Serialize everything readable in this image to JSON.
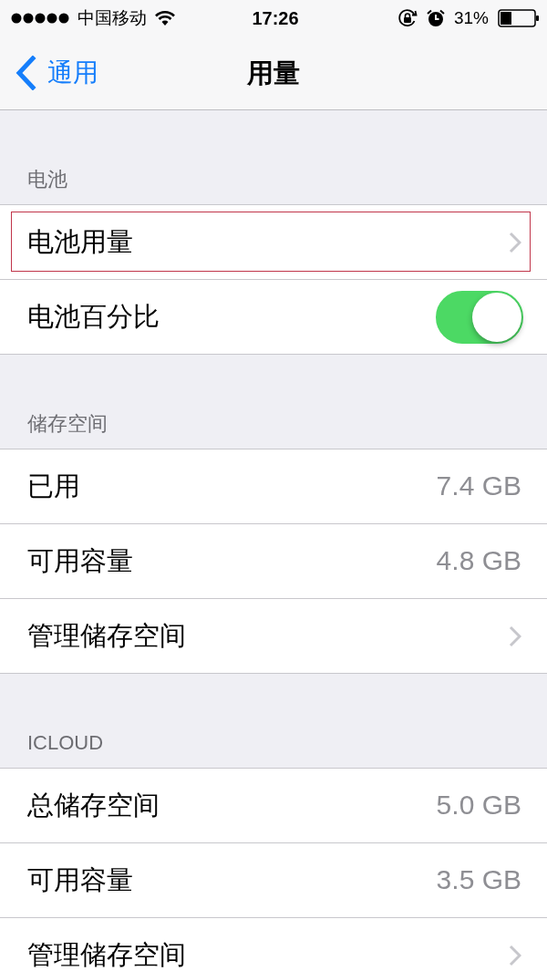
{
  "status_bar": {
    "carrier": "中国移动",
    "time": "17:26",
    "battery_percent": "31%"
  },
  "nav": {
    "back": "通用",
    "title": "用量"
  },
  "sections": [
    {
      "header": "电池",
      "rows": [
        {
          "kind": "link",
          "label": "电池用量",
          "highlighted": true
        },
        {
          "kind": "toggle",
          "label": "电池百分比",
          "on": true
        }
      ]
    },
    {
      "header": "储存空间",
      "rows": [
        {
          "kind": "value",
          "label": "已用",
          "value": "7.4 GB"
        },
        {
          "kind": "value",
          "label": "可用容量",
          "value": "4.8 GB"
        },
        {
          "kind": "link",
          "label": "管理储存空间",
          "highlighted": false
        }
      ]
    },
    {
      "header": "ICLOUD",
      "rows": [
        {
          "kind": "value",
          "label": "总储存空间",
          "value": "5.0 GB"
        },
        {
          "kind": "value",
          "label": "可用容量",
          "value": "3.5 GB"
        },
        {
          "kind": "link",
          "label": "管理储存空间",
          "highlighted": false
        }
      ]
    }
  ]
}
